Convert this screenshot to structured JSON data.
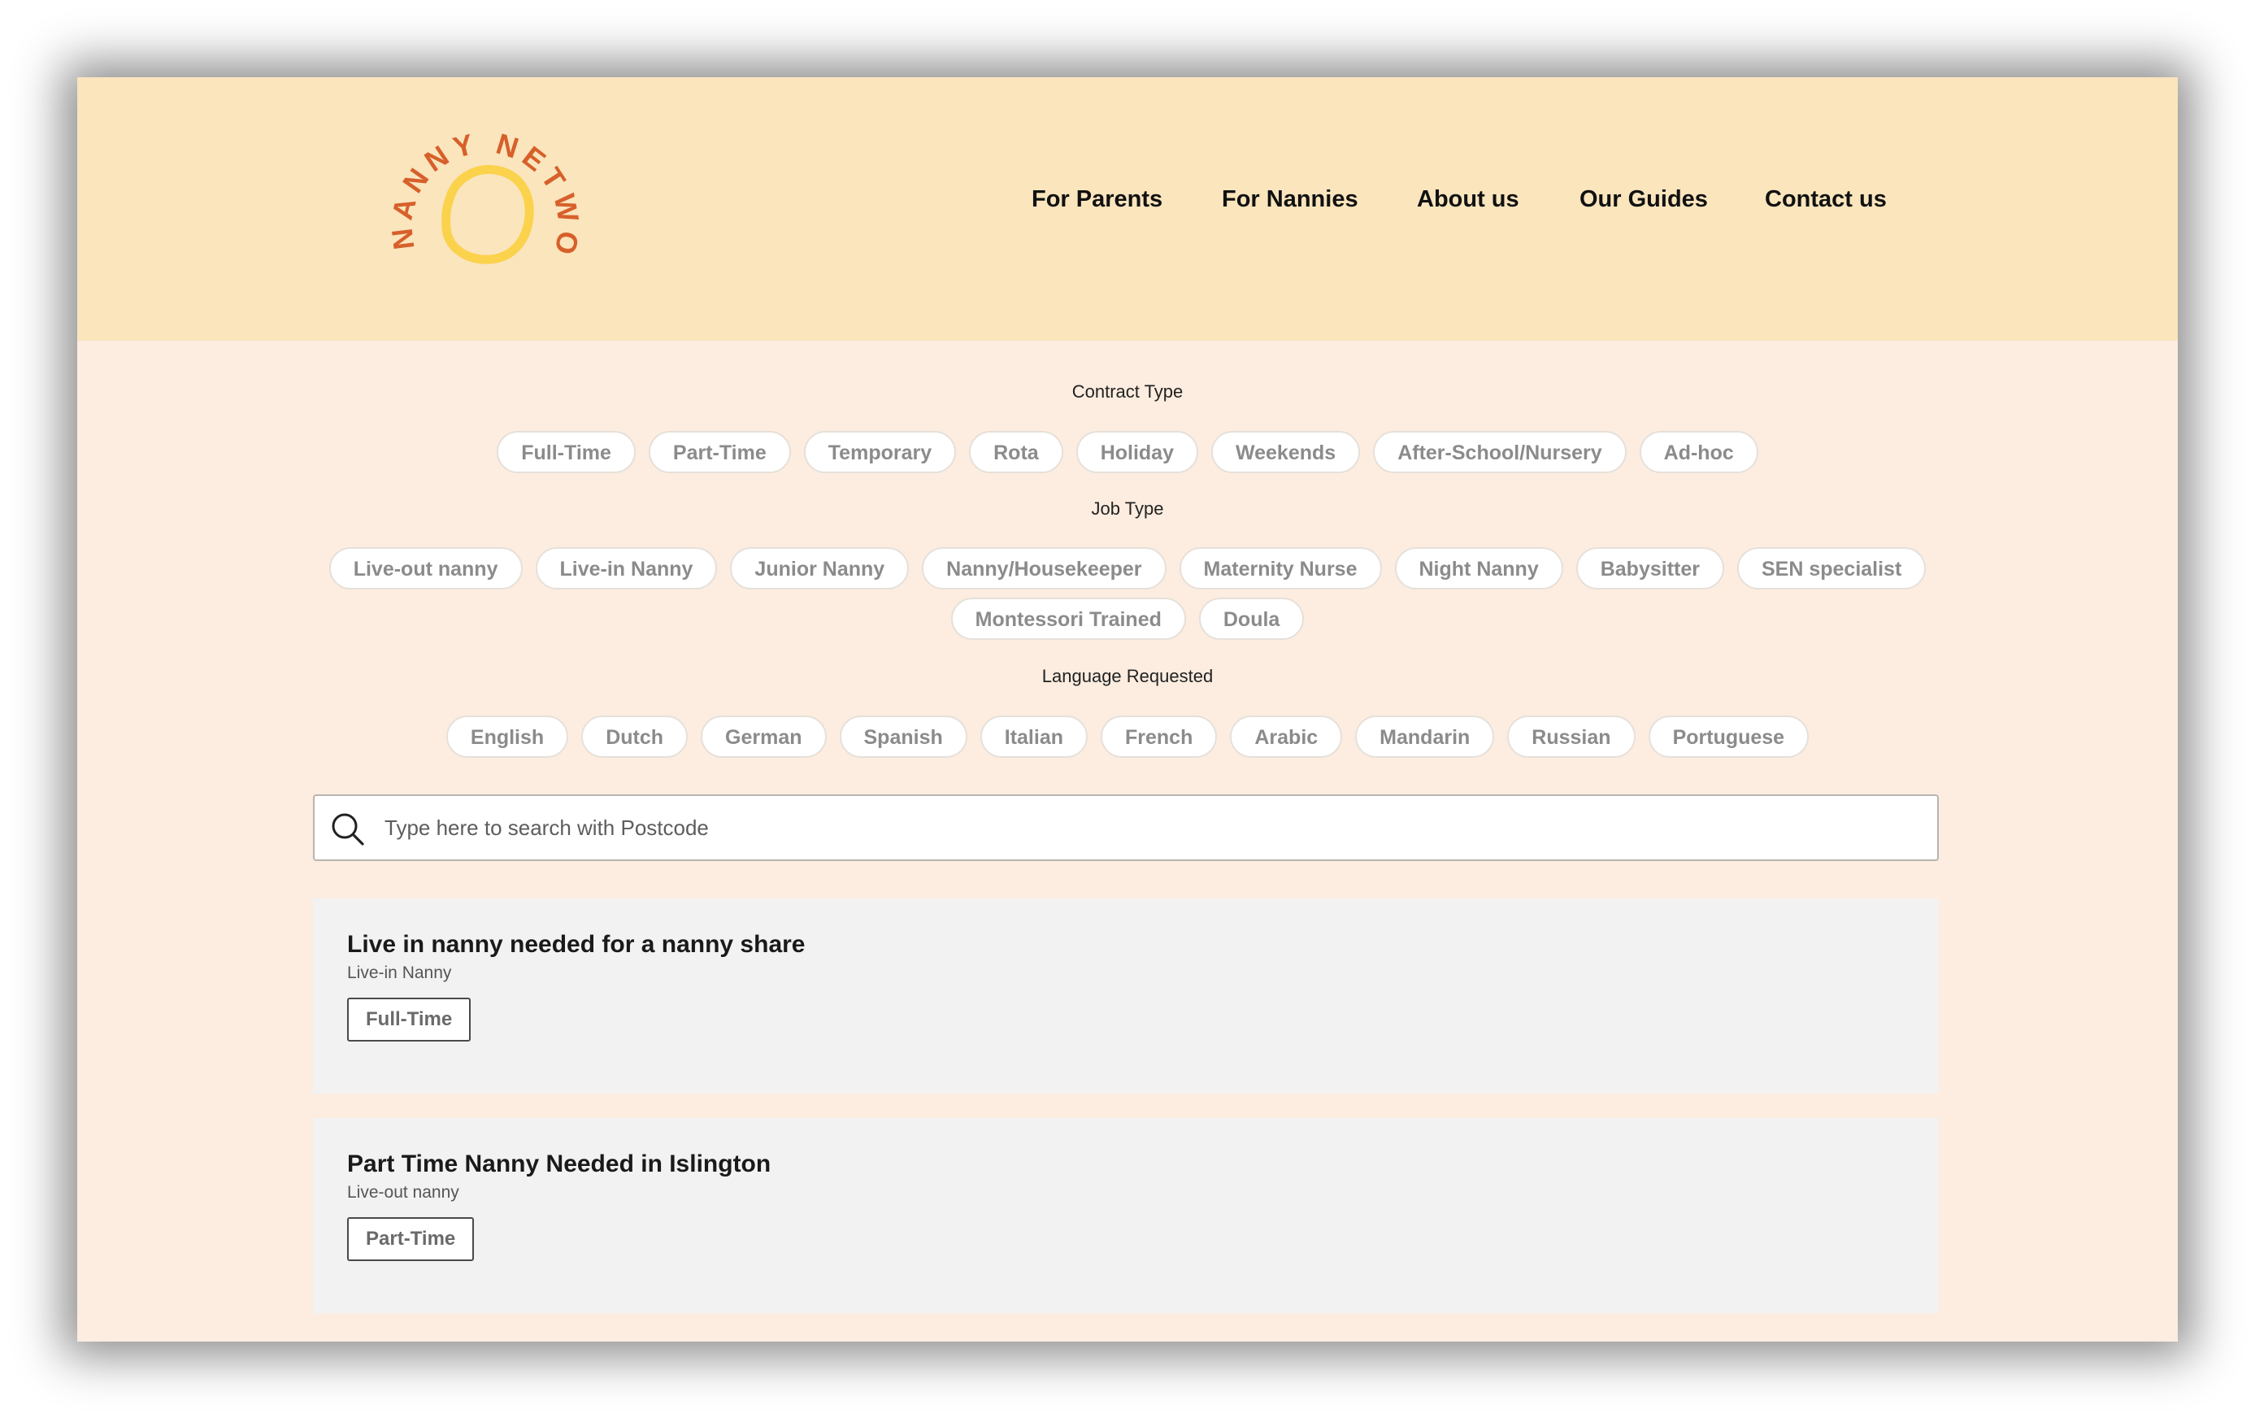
{
  "brand": {
    "logo_text": "NANNY NETWORK",
    "colors": {
      "header": "#fae5bd",
      "page": "#fcede0",
      "logo_sun": "#fbd24c",
      "logo_text": "#d7602a"
    }
  },
  "nav": {
    "items": [
      "For Parents",
      "For Nannies",
      "About us",
      "Our Guides",
      "Contact us"
    ]
  },
  "filters": {
    "contract_type": {
      "title": "Contract Type",
      "options": [
        "Full-Time",
        "Part-Time",
        "Temporary",
        "Rota",
        "Holiday",
        "Weekends",
        "After-School/Nursery",
        "Ad-hoc"
      ]
    },
    "job_type": {
      "title": "Job Type",
      "options": [
        "Live-out nanny",
        "Live-in Nanny",
        "Junior Nanny",
        "Nanny/Housekeeper",
        "Maternity Nurse",
        "Night Nanny",
        "Babysitter",
        "SEN specialist",
        "Montessori Trained",
        "Doula"
      ]
    },
    "language": {
      "title": "Language Requested",
      "options": [
        "English",
        "Dutch",
        "German",
        "Spanish",
        "Italian",
        "French",
        "Arabic",
        "Mandarin",
        "Russian",
        "Portuguese"
      ]
    }
  },
  "search": {
    "placeholder": "Type here to search with Postcode",
    "icon": "search-icon",
    "value": ""
  },
  "jobs": [
    {
      "title": "Live in nanny needed for a nanny share",
      "type": "Live-in Nanny",
      "contract": "Full-Time"
    },
    {
      "title": "Part Time Nanny Needed in Islington",
      "type": "Live-out nanny",
      "contract": "Part-Time"
    }
  ]
}
